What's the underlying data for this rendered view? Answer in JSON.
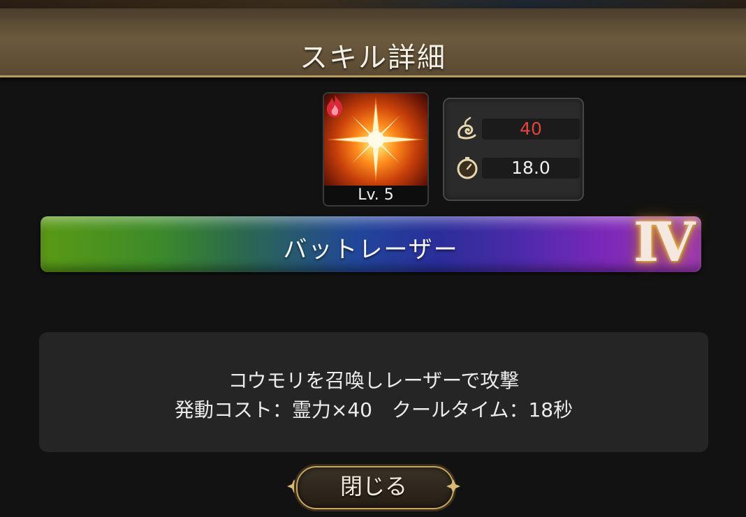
{
  "header": {
    "title": "スキル詳細"
  },
  "skill": {
    "level_label": "Lv. 5",
    "element_icon": "fire-element-icon",
    "art_icon": "starburst-icon",
    "name": "バットレーザー",
    "rank": "Ⅳ"
  },
  "stats": {
    "cost": {
      "icon": "spirit-swirl-icon",
      "value": "40",
      "color": "#e0453c"
    },
    "cooldown": {
      "icon": "stopwatch-icon",
      "value": "18.0",
      "color": "#f0f0f0"
    }
  },
  "description": {
    "line1": "コウモリを召喚しレーザーで攻撃",
    "line2": "発動コスト：霊力×40　クールタイム：18秒"
  },
  "close_button": {
    "label": "閉じる"
  },
  "colors": {
    "header_border": "#b89a5a",
    "button_border": "#c9a660",
    "rank_glow": "#ffd66a"
  }
}
